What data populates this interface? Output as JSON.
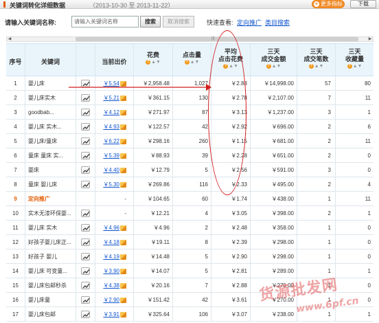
{
  "header": {
    "title": "关键词转化详细数据",
    "date_range": "（2013-10-30 至 2013-11-22）",
    "more_button": "更多指标",
    "download_button": "下载"
  },
  "search": {
    "label": "请输入关键词名称:",
    "placeholder": "请输入关键词名称",
    "search_button": "搜索",
    "cancel_button": "取消搜索",
    "quick_label": "快速查看:",
    "quick_links": [
      "定向推广",
      "类目搜索"
    ]
  },
  "scrollbar": {
    "grip": "|||"
  },
  "table": {
    "columns": {
      "no": "序号",
      "keyword": "关键词",
      "bid": "当前出价",
      "cost": "花费",
      "clicks": "点击量",
      "avg_cpc_1": "平均",
      "avg_cpc_2": "点击花费",
      "amount_1": "三天",
      "amount_2": "成交金额",
      "count_1": "三天",
      "count_2": "成交笔数",
      "fav_1": "三天",
      "fav_2": "收藏量"
    },
    "rows": [
      {
        "no": "1",
        "keyword": "婴儿床",
        "bid": "￥5.54",
        "cost": "￥2,958.48",
        "clicks": "1,027",
        "avg": "￥2.88",
        "amount": "￥14,998.00",
        "count": "57",
        "fav": "80"
      },
      {
        "no": "2",
        "keyword": "婴儿床实木",
        "bid": "￥5.21",
        "cost": "￥361.15",
        "clicks": "130",
        "avg": "￥2.78",
        "amount": "￥2,107.00",
        "count": "7",
        "fav": "11"
      },
      {
        "no": "3",
        "keyword": "goodbab...",
        "bid": "￥4.12",
        "cost": "￥271.97",
        "clicks": "87",
        "avg": "￥3.13",
        "amount": "￥1,237.00",
        "count": "3",
        "fav": "1"
      },
      {
        "no": "4",
        "keyword": "婴儿床 实木...",
        "bid": "￥4.93",
        "cost": "￥122.57",
        "clicks": "42",
        "avg": "￥2.92",
        "amount": "￥696.00",
        "count": "2",
        "fav": "6"
      },
      {
        "no": "5",
        "keyword": "婴儿床/童床",
        "bid": "￥6.22",
        "cost": "￥298.16",
        "clicks": "260",
        "avg": "￥1.15",
        "amount": "￥681.00",
        "count": "2",
        "fav": "11"
      },
      {
        "no": "6",
        "keyword": "童床 童床 实...",
        "bid": "￥5.39",
        "cost": "￥88.93",
        "clicks": "39",
        "avg": "￥2.28",
        "amount": "￥651.00",
        "count": "2",
        "fav": "0"
      },
      {
        "no": "7",
        "keyword": "婴床",
        "bid": "￥4.40",
        "cost": "￥12.79",
        "clicks": "5",
        "avg": "￥2.56",
        "amount": "￥591.00",
        "count": "3",
        "fav": "0"
      },
      {
        "no": "8",
        "keyword": "童床 婴儿床",
        "bid": "￥5.30",
        "cost": "￥269.86",
        "clicks": "116",
        "avg": "￥2.33",
        "amount": "￥495.00",
        "count": "2",
        "fav": "4"
      },
      {
        "no": "9",
        "keyword": "定向推广",
        "bid": "-",
        "cost": "￥104.65",
        "clicks": "60",
        "avg": "￥1.74",
        "amount": "￥438.00",
        "count": "1",
        "fav": "11",
        "highlight": true,
        "no_trend": true,
        "bid_plain": true
      },
      {
        "no": "10",
        "keyword": "实木无漆环保婴...",
        "bid": "-",
        "cost": "￥12.21",
        "clicks": "4",
        "avg": "￥3.05",
        "amount": "￥398.00",
        "count": "2",
        "fav": "1",
        "bid_plain": true
      },
      {
        "no": "11",
        "keyword": "婴儿床 实木",
        "bid": "￥4.96",
        "cost": "￥4.96",
        "clicks": "2",
        "avg": "￥2.48",
        "amount": "￥358.00",
        "count": "1",
        "fav": "0"
      },
      {
        "no": "12",
        "keyword": "好孩子婴儿床正...",
        "bid": "￥4.18",
        "cost": "￥19.11",
        "clicks": "8",
        "avg": "￥2.39",
        "amount": "￥298.00",
        "count": "1",
        "fav": "0"
      },
      {
        "no": "13",
        "keyword": "好孩子 婴儿",
        "bid": "￥4.19",
        "cost": "￥14.48",
        "clicks": "5",
        "avg": "￥2.90",
        "amount": "￥298.00",
        "count": "1",
        "fav": "0"
      },
      {
        "no": "14",
        "keyword": "婴儿床 可变童...",
        "bid": "￥3.90",
        "cost": "￥14.07",
        "clicks": "5",
        "avg": "￥2.81",
        "amount": "￥289.00",
        "count": "1",
        "fav": "1"
      },
      {
        "no": "15",
        "keyword": "婴儿床包邮秒杀",
        "bid": "￥4.38",
        "cost": "￥20.16",
        "clicks": "7",
        "avg": "￥2.88",
        "amount": "￥270.00",
        "count": "1",
        "fav": "0"
      },
      {
        "no": "16",
        "keyword": "婴儿床童",
        "bid": "￥2.90",
        "cost": "￥151.42",
        "clicks": "42",
        "avg": "￥3.61",
        "amount": "￥270.00",
        "count": "1",
        "fav": "0"
      },
      {
        "no": "17",
        "keyword": "婴儿床包邮",
        "bid": "￥3.91",
        "cost": "￥325.64",
        "clicks": "106",
        "avg": "￥3.07",
        "amount": "￥238.00",
        "count": "1",
        "fav": "1"
      }
    ]
  },
  "watermark": {
    "text": "货源批发网",
    "url": "www.6pf.cn"
  },
  "colors": {
    "accent": "#f08a24",
    "link": "#1155cc",
    "annotation": "#d21e1e",
    "header_bg": "#e9f5fb"
  }
}
